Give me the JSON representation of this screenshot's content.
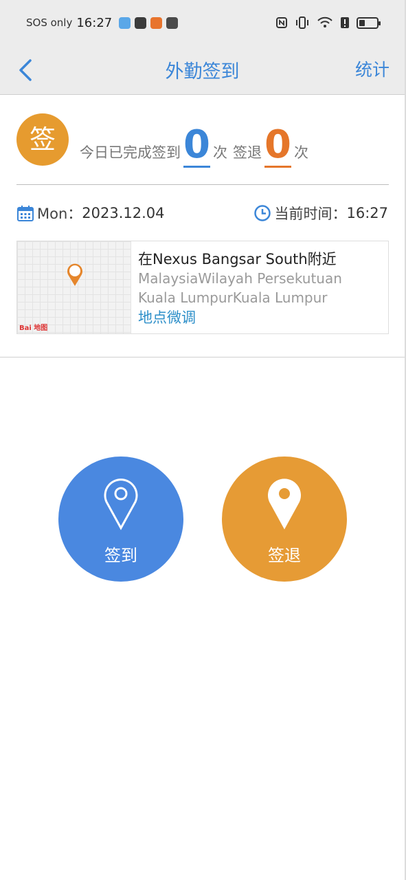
{
  "status_bar": {
    "network": "SOS only",
    "time": "16:27",
    "battery_level": 0.35,
    "icons": [
      "cloud-app-icon",
      "upload-icon",
      "news-app-icon",
      "game-app-icon",
      "nfc-icon",
      "vibrate-icon",
      "wifi-icon",
      "alert-icon",
      "battery-icon"
    ]
  },
  "nav": {
    "title": "外勤签到",
    "action": "统计"
  },
  "summary": {
    "badge": "签",
    "prefix": "今日已完成签到",
    "checkin_count": "0",
    "unit1": "次",
    "checkout_label": "签退",
    "checkout_count": "0",
    "unit2": "次"
  },
  "date": {
    "label": "Mon：",
    "value": "2023.12.04"
  },
  "current_time": {
    "label": "当前时间：",
    "value": "16:27"
  },
  "location": {
    "name": "在Nexus Bangsar South附近",
    "address": "MalaysiaWilayah Persekutuan Kuala LumpurKuala Lumpur",
    "adjust": "地点微调",
    "map_watermark": "Bai 地图"
  },
  "actions": {
    "check_in": "签到",
    "check_out": "签退"
  },
  "colors": {
    "primary_blue": "#3b86d8",
    "check_in_button": "#4a88e0",
    "check_out_button": "#e69b35",
    "badge_orange": "#e69b2f",
    "checkout_count_orange": "#e5762a"
  }
}
